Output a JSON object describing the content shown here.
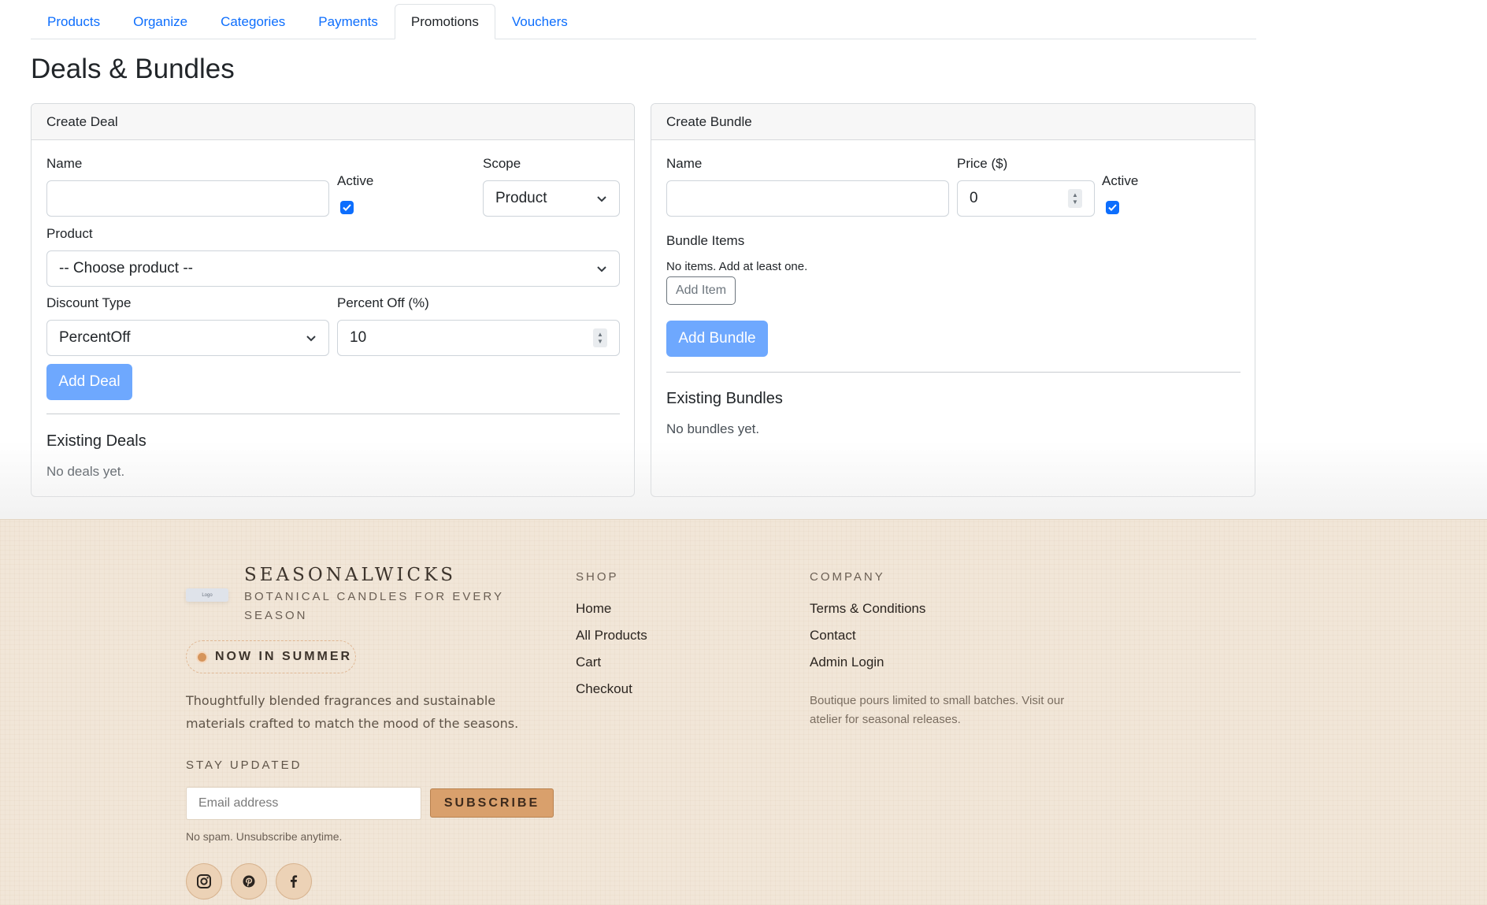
{
  "tabs": [
    "Products",
    "Organize",
    "Categories",
    "Payments",
    "Promotions",
    "Vouchers"
  ],
  "active_tab": "Promotions",
  "page_title": "Deals & Bundles",
  "deal": {
    "header": "Create Deal",
    "name_label": "Name",
    "name_value": "",
    "active_label": "Active",
    "active_checked": true,
    "scope_label": "Scope",
    "scope_value": "Product",
    "product_label": "Product",
    "product_value": "-- Choose product --",
    "discount_type_label": "Discount Type",
    "discount_type_value": "PercentOff",
    "percent_label": "Percent Off (%)",
    "percent_value": "10",
    "add_button": "Add Deal",
    "existing_title": "Existing Deals",
    "existing_empty": "No deals yet."
  },
  "bundle": {
    "header": "Create Bundle",
    "name_label": "Name",
    "name_value": "",
    "price_label": "Price ($)",
    "price_value": "0",
    "active_label": "Active",
    "active_checked": true,
    "items_label": "Bundle Items",
    "items_empty": "No items. Add at least one.",
    "add_item_button": "Add Item",
    "add_button": "Add Bundle",
    "existing_title": "Existing Bundles",
    "existing_empty": "No bundles yet."
  },
  "footer": {
    "logo_text": "Logo",
    "brand_name": "SEASONALWICKS",
    "brand_tagline": "BOTANICAL CANDLES FOR EVERY SEASON",
    "season_badge": "NOW IN SUMMER",
    "description": "Thoughtfully blended fragrances and sustainable materials crafted to match the mood of the seasons.",
    "stay_updated": "STAY UPDATED",
    "email_placeholder": "Email address",
    "subscribe_button": "SUBSCRIBE",
    "no_spam": "No spam. Unsubscribe anytime.",
    "social": [
      "instagram-icon",
      "pinterest-icon",
      "facebook-icon"
    ],
    "shop_heading": "SHOP",
    "shop_links": [
      "Home",
      "All Products",
      "Cart",
      "Checkout"
    ],
    "company_heading": "COMPANY",
    "company_links": [
      "Terms & Conditions",
      "Contact",
      "Admin Login"
    ],
    "company_note": "Boutique pours limited to small batches. Visit our atelier for seasonal releases."
  },
  "colors": {
    "link": "#0d6efd",
    "primary_button": "#6ea8fe",
    "footer_bg": "#f1e6d8",
    "subscribe_bg": "#d9a06c",
    "accent_dot": "#d6955c"
  }
}
